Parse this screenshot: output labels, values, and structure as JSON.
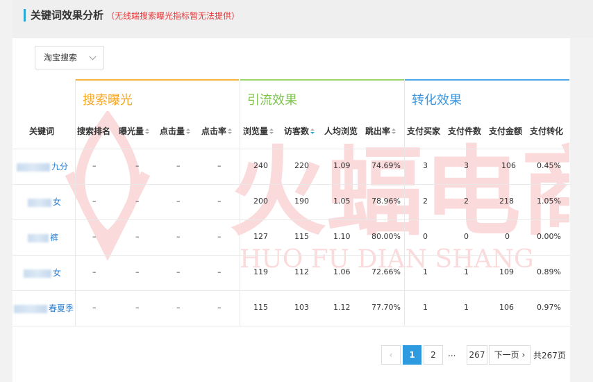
{
  "header": {
    "title": "关键词效果分析",
    "note": "（无线端搜索曝光指标暂无法提供）"
  },
  "filter": {
    "selected": "淘宝搜索"
  },
  "groups": {
    "search_exposure": "搜索曝光",
    "traffic": "引流效果",
    "conversion": "转化效果"
  },
  "columns": {
    "keyword": "关键词",
    "search_rank": "搜索排名",
    "impressions": "曝光量",
    "clicks": "点击量",
    "ctr": "点击率",
    "pageviews": "浏览量",
    "visitors": "访客数",
    "avg_pv": "人均浏览",
    "bounce_rate": "跳出率",
    "buyers": "支付买家",
    "items": "支付件数",
    "amount": "支付金额",
    "conversion": "支付转化"
  },
  "rows": [
    {
      "keyword": "九分",
      "search_rank": "–",
      "impressions": "–",
      "clicks": "–",
      "ctr": "–",
      "pageviews": "240",
      "visitors": "220",
      "avg_pv": "1.09",
      "bounce_rate": "74.69%",
      "buyers": "3",
      "items": "3",
      "amount": "106",
      "conversion": "0.45%"
    },
    {
      "keyword": "女",
      "search_rank": "–",
      "impressions": "–",
      "clicks": "–",
      "ctr": "–",
      "pageviews": "200",
      "visitors": "190",
      "avg_pv": "1.05",
      "bounce_rate": "78.96%",
      "buyers": "2",
      "items": "2",
      "amount": "218",
      "conversion": "1.05%"
    },
    {
      "keyword": "裤",
      "search_rank": "–",
      "impressions": "–",
      "clicks": "–",
      "ctr": "–",
      "pageviews": "127",
      "visitors": "115",
      "avg_pv": "1.10",
      "bounce_rate": "80.00%",
      "buyers": "0",
      "items": "0",
      "amount": "0",
      "conversion": "0.00%"
    },
    {
      "keyword": "女",
      "search_rank": "–",
      "impressions": "–",
      "clicks": "–",
      "ctr": "–",
      "pageviews": "119",
      "visitors": "112",
      "avg_pv": "1.06",
      "bounce_rate": "72.66%",
      "buyers": "1",
      "items": "1",
      "amount": "109",
      "conversion": "0.89%"
    },
    {
      "keyword": "春夏季",
      "search_rank": "–",
      "impressions": "–",
      "clicks": "–",
      "ctr": "–",
      "pageviews": "115",
      "visitors": "103",
      "avg_pv": "1.12",
      "bounce_rate": "77.70%",
      "buyers": "1",
      "items": "1",
      "amount": "106",
      "conversion": "0.97%"
    }
  ],
  "pagination": {
    "prev": "‹",
    "page1": "1",
    "page2": "2",
    "ellipsis": "...",
    "last": "267",
    "next": "下一页",
    "next_arrow": "›",
    "total": "共267页"
  },
  "watermark": {
    "main": "火蝠电商",
    "sub": "HUO FU DIAN SHANG"
  },
  "colors": {
    "accent": "#2e9be0",
    "exposure": "#f5a623",
    "traffic": "#7dc44e",
    "conversion": "#3c97e0",
    "warning": "#e4393c"
  }
}
